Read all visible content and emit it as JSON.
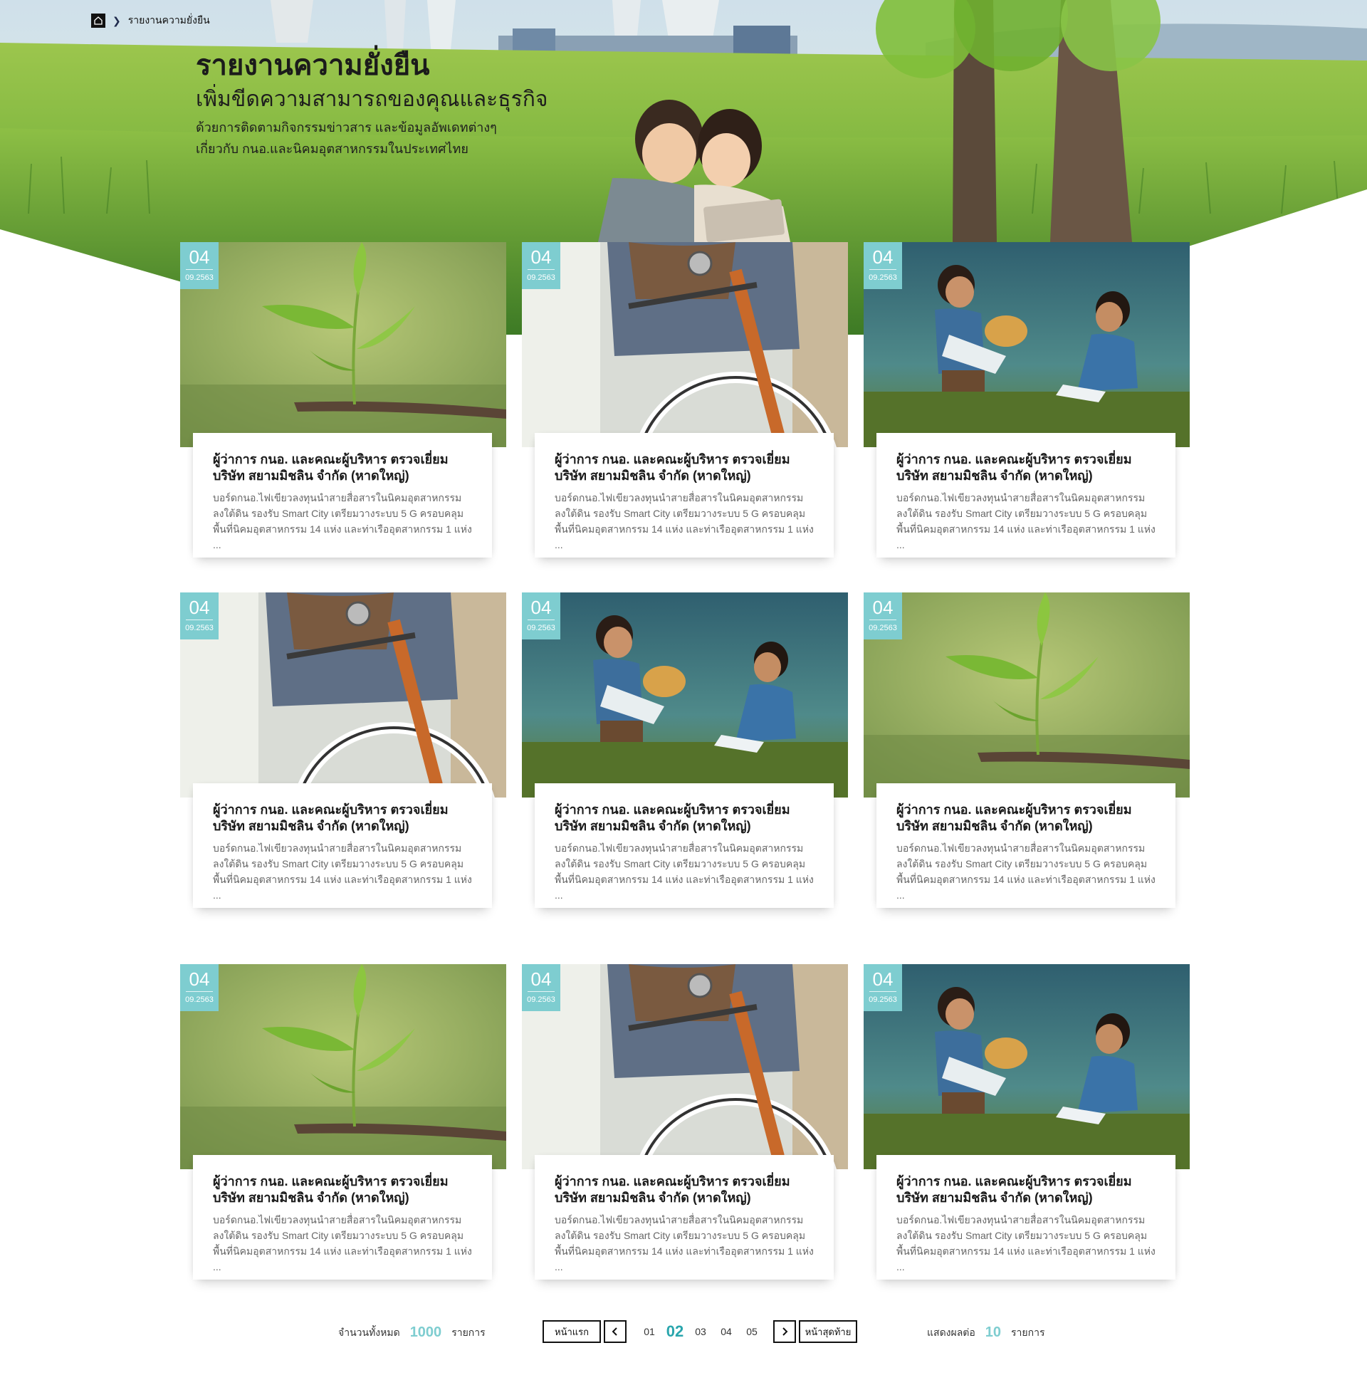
{
  "breadcrumb": {
    "home_icon": "home-icon",
    "current": "รายงานความยั่งยืน"
  },
  "hero": {
    "title": "รายงานความยั่งยืน",
    "subtitle": "เพิ่มขีดความสามารถของคุณและธุรกิจ",
    "description": "ด้วยการติดตามกิจกรรมข่าวสาร และข้อมูลอัพเดทต่างๆ เกี่ยวกับ กนอ.และนิคมอุตสาหกรรมในประเทศไทย"
  },
  "cards": [
    {
      "day": "04",
      "month": "09.2563",
      "image": "sprout",
      "title": "ผู้ว่าการ กนอ. และคณะผู้บริหาร ตรวจเยี่ยมบริษัท สยามมิชลิน จำกัด (หาดใหญ่)",
      "excerpt": "บอร์ดกนอ.ไฟเขียวลงทุนนำสายสื่อสารในนิคมอุตสาหกรรมลงใต้ดิน รองรับ Smart City เตรียมวางระบบ 5 G ครอบคลุมพื้นที่นิคมอุตสาหกรรม 14 แห่ง และท่าเรืออุตสาหกรรม 1 แห่ง ..."
    },
    {
      "day": "04",
      "month": "09.2563",
      "image": "bicycle",
      "title": "ผู้ว่าการ กนอ. และคณะผู้บริหาร ตรวจเยี่ยมบริษัท สยามมิชลิน จำกัด (หาดใหญ่)",
      "excerpt": "บอร์ดกนอ.ไฟเขียวลงทุนนำสายสื่อสารในนิคมอุตสาหกรรมลงใต้ดิน รองรับ Smart City เตรียมวางระบบ 5 G ครอบคลุมพื้นที่นิคมอุตสาหกรรม 14 แห่ง และท่าเรืออุตสาหกรรม 1 แห่ง ..."
    },
    {
      "day": "04",
      "month": "09.2563",
      "image": "kids",
      "title": "ผู้ว่าการ กนอ. และคณะผู้บริหาร ตรวจเยี่ยมบริษัท สยามมิชลิน จำกัด (หาดใหญ่)",
      "excerpt": "บอร์ดกนอ.ไฟเขียวลงทุนนำสายสื่อสารในนิคมอุตสาหกรรมลงใต้ดิน รองรับ Smart City เตรียมวางระบบ 5 G ครอบคลุมพื้นที่นิคมอุตสาหกรรม 14 แห่ง และท่าเรืออุตสาหกรรม 1 แห่ง ..."
    },
    {
      "day": "04",
      "month": "09.2563",
      "image": "bicycle",
      "title": "ผู้ว่าการ กนอ. และคณะผู้บริหาร ตรวจเยี่ยมบริษัท สยามมิชลิน จำกัด (หาดใหญ่)",
      "excerpt": "บอร์ดกนอ.ไฟเขียวลงทุนนำสายสื่อสารในนิคมอุตสาหกรรมลงใต้ดิน รองรับ Smart City เตรียมวางระบบ 5 G ครอบคลุมพื้นที่นิคมอุตสาหกรรม 14 แห่ง และท่าเรืออุตสาหกรรม 1 แห่ง ..."
    },
    {
      "day": "04",
      "month": "09.2563",
      "image": "kids",
      "title": "ผู้ว่าการ กนอ. และคณะผู้บริหาร ตรวจเยี่ยมบริษัท สยามมิชลิน จำกัด (หาดใหญ่)",
      "excerpt": "บอร์ดกนอ.ไฟเขียวลงทุนนำสายสื่อสารในนิคมอุตสาหกรรมลงใต้ดิน รองรับ Smart City เตรียมวางระบบ 5 G ครอบคลุมพื้นที่นิคมอุตสาหกรรม 14 แห่ง และท่าเรืออุตสาหกรรม 1 แห่ง ..."
    },
    {
      "day": "04",
      "month": "09.2563",
      "image": "sprout",
      "title": "ผู้ว่าการ กนอ. และคณะผู้บริหาร ตรวจเยี่ยมบริษัท สยามมิชลิน จำกัด (หาดใหญ่)",
      "excerpt": "บอร์ดกนอ.ไฟเขียวลงทุนนำสายสื่อสารในนิคมอุตสาหกรรมลงใต้ดิน รองรับ Smart City เตรียมวางระบบ 5 G ครอบคลุมพื้นที่นิคมอุตสาหกรรม 14 แห่ง และท่าเรืออุตสาหกรรม 1 แห่ง ..."
    },
    {
      "day": "04",
      "month": "09.2563",
      "image": "sprout",
      "title": "ผู้ว่าการ กนอ. และคณะผู้บริหาร ตรวจเยี่ยมบริษัท สยามมิชลิน จำกัด (หาดใหญ่)",
      "excerpt": "บอร์ดกนอ.ไฟเขียวลงทุนนำสายสื่อสารในนิคมอุตสาหกรรมลงใต้ดิน รองรับ Smart City เตรียมวางระบบ 5 G ครอบคลุมพื้นที่นิคมอุตสาหกรรม 14 แห่ง และท่าเรืออุตสาหกรรม 1 แห่ง ..."
    },
    {
      "day": "04",
      "month": "09.2563",
      "image": "bicycle",
      "title": "ผู้ว่าการ กนอ. และคณะผู้บริหาร ตรวจเยี่ยมบริษัท สยามมิชลิน จำกัด (หาดใหญ่)",
      "excerpt": "บอร์ดกนอ.ไฟเขียวลงทุนนำสายสื่อสารในนิคมอุตสาหกรรมลงใต้ดิน รองรับ Smart City เตรียมวางระบบ 5 G ครอบคลุมพื้นที่นิคมอุตสาหกรรม 14 แห่ง และท่าเรืออุตสาหกรรม 1 แห่ง ..."
    },
    {
      "day": "04",
      "month": "09.2563",
      "image": "kids",
      "title": "ผู้ว่าการ กนอ. และคณะผู้บริหาร ตรวจเยี่ยมบริษัท สยามมิชลิน จำกัด (หาดใหญ่)",
      "excerpt": "บอร์ดกนอ.ไฟเขียวลงทุนนำสายสื่อสารในนิคมอุตสาหกรรมลงใต้ดิน รองรับ Smart City เตรียมวางระบบ 5 G ครอบคลุมพื้นที่นิคมอุตสาหกรรม 14 แห่ง และท่าเรืออุตสาหกรรม 1 แห่ง ..."
    }
  ],
  "pagination": {
    "total_label": "จำนวนทั้งหมด",
    "total_count": "1000",
    "total_unit": "รายการ",
    "first_label": "หน้าแรก",
    "last_label": "หน้าสุดท้าย",
    "prev_icon": "chevron-left-icon",
    "next_icon": "chevron-right-icon",
    "pages": [
      "01",
      "02",
      "03",
      "04",
      "05"
    ],
    "current_page": "02",
    "per_page_label": "แสดงผลต่อ",
    "per_page_count": "10",
    "per_page_unit": "รายการ"
  },
  "colors": {
    "accent": "#7ecdd0",
    "active_page": "#2aa6ad",
    "grass": "#6ea83a",
    "sky": "#cfe3ee"
  }
}
